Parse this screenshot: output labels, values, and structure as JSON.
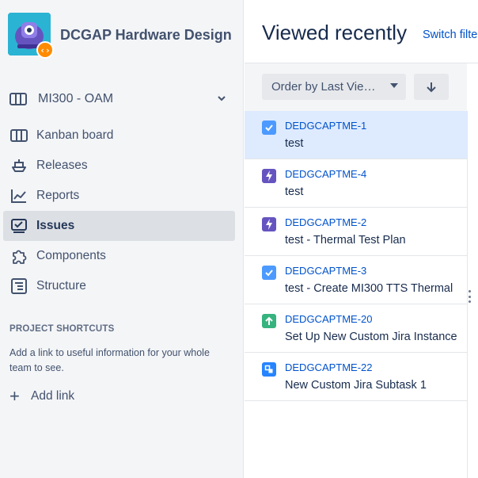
{
  "project": {
    "name": "DCGAP Hardware Design",
    "badge": "‹›"
  },
  "board_selector": {
    "label": "MI300 - OAM"
  },
  "nav": {
    "items": [
      {
        "label": "Kanban board",
        "icon": "board-icon"
      },
      {
        "label": "Releases",
        "icon": "ship-icon"
      },
      {
        "label": "Reports",
        "icon": "chart-line-icon"
      },
      {
        "label": "Issues",
        "icon": "issues-icon",
        "active": true
      },
      {
        "label": "Components",
        "icon": "puzzle-icon"
      },
      {
        "label": "Structure",
        "icon": "structure-icon"
      }
    ]
  },
  "shortcuts": {
    "title": "PROJECT SHORTCUTS",
    "description": "Add a link to useful information for your whole team to see.",
    "add_link": "Add link"
  },
  "main": {
    "title": "Viewed recently",
    "switch_filter": "Switch filter",
    "order_by": "Order by Last Vie…"
  },
  "issues": [
    {
      "key": "DEDGCAPTME-1",
      "summary": "test",
      "type": "task",
      "selected": true
    },
    {
      "key": "DEDGCAPTME-4",
      "summary": "test",
      "type": "epic"
    },
    {
      "key": "DEDGCAPTME-2",
      "summary": "test - Thermal Test Plan",
      "type": "epic"
    },
    {
      "key": "DEDGCAPTME-3",
      "summary": "test - Create MI300 TTS Thermal",
      "type": "task"
    },
    {
      "key": "DEDGCAPTME-20",
      "summary": "Set Up New Custom Jira Instance",
      "type": "improvement"
    },
    {
      "key": "DEDGCAPTME-22",
      "summary": "New Custom Jira Subtask 1",
      "type": "subtask"
    }
  ],
  "colors": {
    "task": "#4c9aff",
    "epic": "#6554c0",
    "improvement": "#36b37e",
    "subtask": "#2684ff",
    "link": "#0052cc",
    "selected_row": "#deebff"
  }
}
